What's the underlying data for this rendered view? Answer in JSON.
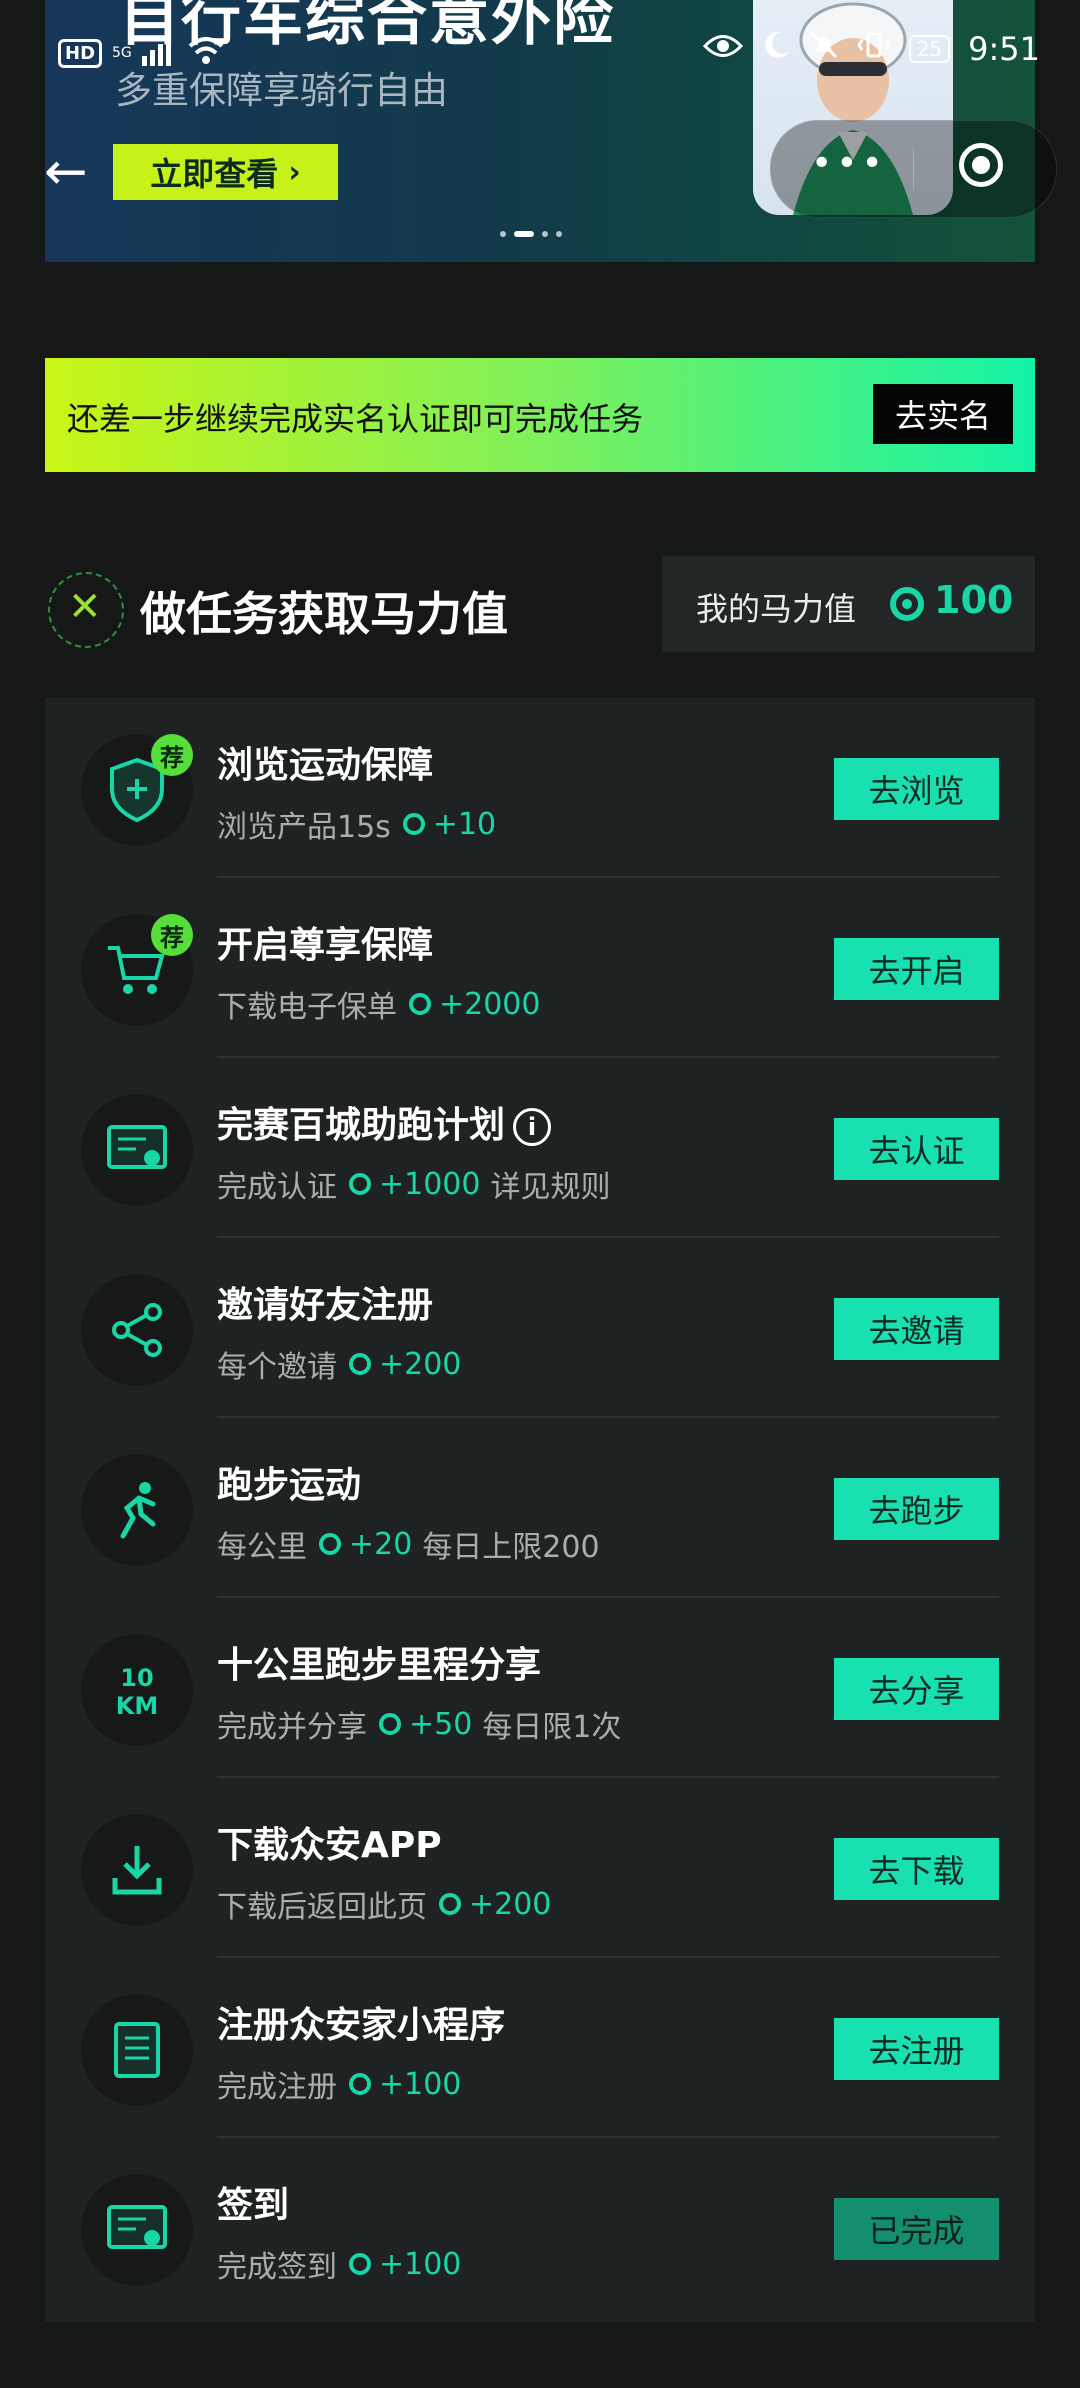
{
  "banner": {
    "title": "自行车综合意外险",
    "subtitle": "多重保障享骑行自由",
    "cta": "立即查看"
  },
  "status_bar": {
    "hd": "HD",
    "network": "5G",
    "battery": "25",
    "time": "9:51"
  },
  "notice": {
    "text": "还差一步继续完成实名认证即可完成任务",
    "button": "去实名"
  },
  "section": {
    "title": "做任务获取马力值",
    "points_label": "我的马力值",
    "points_value": "100"
  },
  "tasks": [
    {
      "title": "浏览运动保障",
      "desc": "浏览产品15s",
      "points": "+10",
      "extra": "",
      "button": "去浏览",
      "badge": "荐",
      "icon": "shield-icon"
    },
    {
      "title": "开启尊享保障",
      "desc": "下载电子保单",
      "points": "+2000",
      "extra": "",
      "button": "去开启",
      "badge": "荐",
      "icon": "cart-icon"
    },
    {
      "title": "完赛百城助跑计划",
      "desc": "完成认证",
      "points": "+1000",
      "extra": "详见规则",
      "button": "去认证",
      "badge": "",
      "icon": "certificate-icon"
    },
    {
      "title": "邀请好友注册",
      "desc": "每个邀请",
      "points": "+200",
      "extra": "",
      "button": "去邀请",
      "badge": "",
      "icon": "share-icon"
    },
    {
      "title": "跑步运动",
      "desc": "每公里",
      "points": "+20",
      "extra": "每日上限200",
      "button": "去跑步",
      "badge": "",
      "icon": "runner-icon"
    },
    {
      "title": "十公里跑步里程分享",
      "desc": "完成并分享",
      "points": "+50",
      "extra": "每日限1次",
      "button": "去分享",
      "badge": "",
      "icon": "10km-icon"
    },
    {
      "title": "下载众安APP",
      "desc": "下载后返回此页",
      "points": "+200",
      "extra": "",
      "button": "去下载",
      "badge": "",
      "icon": "download-icon"
    },
    {
      "title": "注册众安家小程序",
      "desc": "完成注册",
      "points": "+100",
      "extra": "",
      "button": "去注册",
      "badge": "",
      "icon": "document-icon"
    },
    {
      "title": "签到",
      "desc": "完成签到",
      "points": "+100",
      "extra": "",
      "button": "已完成",
      "badge": "",
      "icon": "certificate-icon"
    }
  ],
  "colors": {
    "accent": "#19e0b0",
    "badge": "#56df3a",
    "background": "#161817"
  }
}
